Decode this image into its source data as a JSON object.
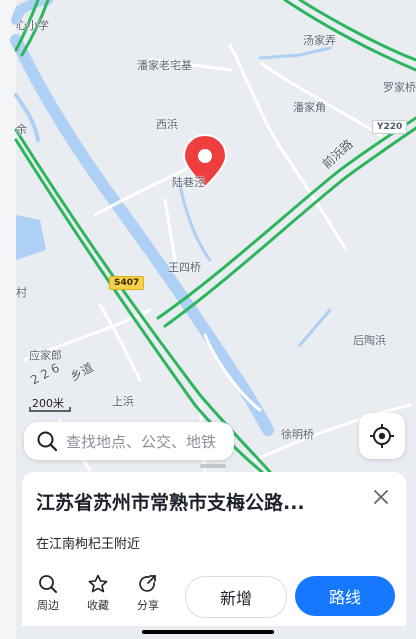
{
  "map": {
    "labels": {
      "school": "心小学",
      "panjialaozhaiji": "潘家老宅基",
      "tangjianong": "汤家弄",
      "luojia": "罗家桥",
      "xibang": "西浜",
      "panjiajiao": "潘家角",
      "luxiangjing": "陆巷泾",
      "wangsiqiao": "王四桥",
      "cun": "村",
      "yingjialang": "应家郎",
      "houtaobang": "后陶浜",
      "shangbang": "上浜",
      "xuqiaoqiao": "徐明桥",
      "road_qianbang": "前浜路",
      "road_xiang": "乡道",
      "road_num": "2 2 6",
      "edge_yu": "余"
    },
    "badges": {
      "s407": "S407",
      "y220": "Y220"
    },
    "scale": "200米",
    "colors": {
      "water": "#aed0f5",
      "highway": "#2db55d",
      "road": "#ffffff",
      "pin": "#ef3e3e"
    }
  },
  "search": {
    "placeholder": "查找地点、公交、地铁"
  },
  "card": {
    "title": "江苏省苏州市常熟市支梅公路...",
    "subtitle": "在江南枸杞王附近"
  },
  "bottom_bar": {
    "nearby": "周边",
    "favorite": "收藏",
    "share": "分享",
    "add": "新增",
    "route": "路线"
  }
}
